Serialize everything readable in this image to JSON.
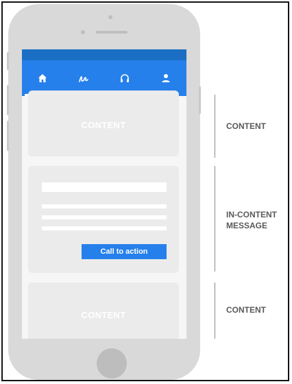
{
  "nav": {
    "items": [
      {
        "icon": "home-icon",
        "active": true
      },
      {
        "icon": "scribble-icon",
        "active": false
      },
      {
        "icon": "headphones-icon",
        "active": false
      },
      {
        "icon": "profile-icon",
        "active": false
      }
    ]
  },
  "cards": {
    "top_label": "CONTENT",
    "bottom_label": "CONTENT",
    "message": {
      "cta_label": "Call to action"
    }
  },
  "annotations": {
    "content_top": "CONTENT",
    "in_content_line1": "IN-CONTENT",
    "in_content_line2": "MESSAGE",
    "content_bottom": "CONTENT"
  },
  "colors": {
    "accent": "#2680eb",
    "status_bar": "#1a6fc4",
    "card": "#ebebeb",
    "phone": "#d9d9d9"
  }
}
